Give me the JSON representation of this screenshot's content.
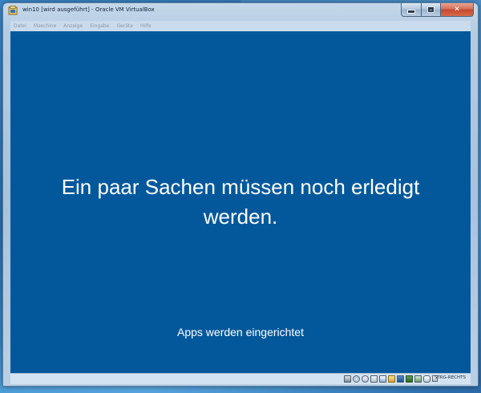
{
  "window": {
    "title": "win10 [wird ausgeführt] - Oracle VM VirtualBox",
    "controls": {
      "minimize": "minimize",
      "maximize": "maximize",
      "close": "✕"
    }
  },
  "menubar": {
    "items": [
      "Datei",
      "Maschine",
      "Anzeige",
      "Eingabe",
      "Geräte",
      "Hilfe"
    ]
  },
  "guest": {
    "background_color": "#03589b",
    "heading": "Ein paar Sachen müssen noch erledigt\nwerden.",
    "status": "Apps werden eingerichtet"
  },
  "statusbar": {
    "icons": [
      "hard-disk-icon",
      "optical-drive-icon",
      "audio-icon",
      "network-icon",
      "usb-icon",
      "shared-folder-icon",
      "display-icon",
      "video-capture-icon",
      "cpu-icon",
      "mouse-integration-icon"
    ],
    "host_key": "STRG-RECHTS"
  }
}
